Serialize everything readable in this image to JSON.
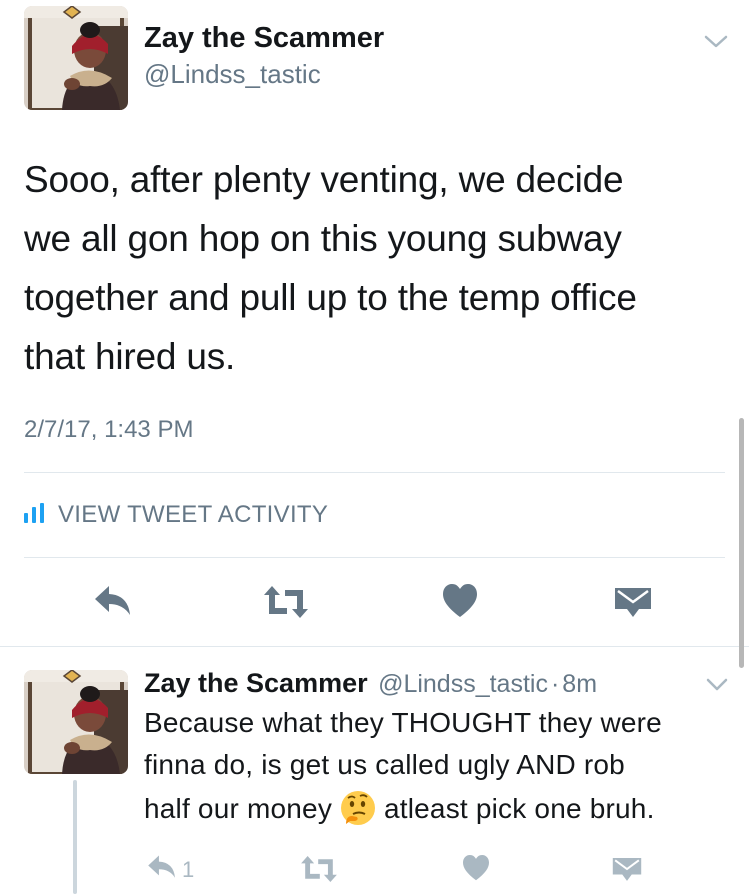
{
  "main_tweet": {
    "author": {
      "display_name": "Zay the Scammer",
      "handle": "@Lindss_tastic",
      "avatar_icon": "profile-photo"
    },
    "text": "Sooo, after plenty venting, we decide we all gon hop on this young subway together and pull up to the temp office that hired us.",
    "lines": [
      "Sooo, after plenty venting, we decide",
      "we all gon hop on this young subway",
      "together and pull up to the temp office",
      "that hired us."
    ],
    "timestamp": "2/7/17, 1:43 PM",
    "view_activity_label": "VIEW TWEET ACTIVITY",
    "actions": [
      "reply-icon",
      "retweet-icon",
      "like-icon",
      "direct-message-icon"
    ]
  },
  "reply_tweet": {
    "author": {
      "display_name": "Zay the Scammer",
      "handle": "@Lindss_tastic",
      "age": "8m"
    },
    "separator": "·",
    "line1": "Because what they THOUGHT they were",
    "line2": "finna do, is get us called ugly AND rob",
    "line3_before_emoji": "half our money",
    "emoji": "thinking-face",
    "line3_after_emoji": "atleast pick one bruh.",
    "reply_count": "1",
    "actions": [
      "reply-icon",
      "retweet-icon",
      "like-icon",
      "direct-message-icon"
    ]
  },
  "colors": {
    "text": "#14171a",
    "secondary": "#657786",
    "icon": "#657786",
    "icon_light": "#aab8c2",
    "divider": "#e1e8ed"
  }
}
